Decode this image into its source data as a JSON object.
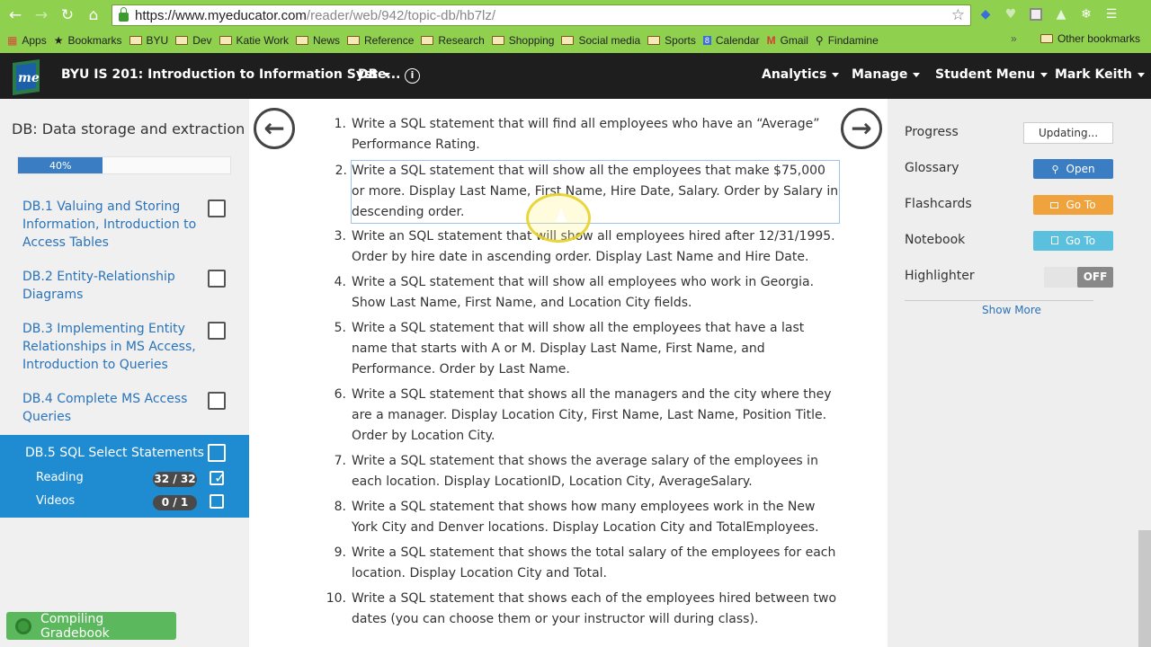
{
  "browser": {
    "url_host": "https://www.myeducator.com",
    "url_path": "/reader/web/942/topic-db/hb7lz/",
    "bookmarks": [
      "Apps",
      "Bookmarks",
      "BYU",
      "Dev",
      "Katie Work",
      "News",
      "Reference",
      "Research",
      "Shopping",
      "Social media",
      "Sports",
      "Calendar",
      "Gmail",
      "Findamine"
    ],
    "other_bookmarks": "Other bookmarks",
    "overflow": "»"
  },
  "appbar": {
    "course": "BYU IS 201: Introduction to Information Syste...",
    "db_menu": "DB",
    "analytics": "Analytics",
    "manage": "Manage",
    "student_menu": "Student Menu",
    "user": "Mark Keith",
    "logo_text": "me"
  },
  "sidebar": {
    "title": "DB: Data storage and extraction",
    "progress": "40%",
    "progress_value": 0.4,
    "sections": [
      {
        "label": "DB.1 Valuing and Storing Information, Introduction to Access Tables"
      },
      {
        "label": "DB.2 Entity-Relationship Diagrams"
      },
      {
        "label": "DB.3 Implementing Entity Relationships in MS Access, Introduction to Queries"
      },
      {
        "label": "DB.4 Complete MS Access Queries"
      }
    ],
    "active": {
      "label": "DB.5 SQL Select Statements",
      "reading_label": "Reading",
      "reading_badge": "32 / 32",
      "videos_label": "Videos",
      "videos_badge": "0 / 1"
    },
    "gradebook": "Compiling Gradebook"
  },
  "main": {
    "questions": [
      {
        "num": "1.",
        "text": "Write a SQL statement that will find all employees who have an “Average” Performance Rating."
      },
      {
        "num": "2.",
        "text": "Write a SQL statement that will show all the employees that make $75,000 or more. Display Last Name, First Name, Hire Date, Salary. Order by Salary in descending order."
      },
      {
        "num": "3.",
        "text": "Write an SQL statement that will show all employees hired after 12/31/1995. Order by hire date in ascending order. Display Last Name and Hire Date."
      },
      {
        "num": "4.",
        "text": "Write a SQL statement that will show all employees who work in Georgia. Show Last Name, First Name, and Location City fields."
      },
      {
        "num": "5.",
        "text": "Write a SQL statement that will show all the employees that have a last name that starts with A or M. Display Last Name, First Name, and Performance. Order by Last Name."
      },
      {
        "num": "6.",
        "text": "Write a SQL statement that shows all the managers and the city where they are a manager. Display Location City, First Name, Last Name, Position Title. Order by Location City."
      },
      {
        "num": "7.",
        "text": "Write a SQL statement that shows the average salary of the employees in each location. Display LocationID, Location City, AverageSalary."
      },
      {
        "num": "8.",
        "text": "Write a SQL statement that shows how many employees work in the New York City and Denver locations. Display Location City and TotalEmployees."
      },
      {
        "num": "9.",
        "text": "Write a SQL statement that shows the total salary of the employees for each location. Display Location City and Total."
      },
      {
        "num": "10.",
        "text": "Write a SQL statement that shows each of the employees hired between two dates (you can choose them or your instructor will during class)."
      }
    ]
  },
  "right": {
    "progress_label": "Progress",
    "progress_status": "Updating...",
    "glossary_label": "Glossary",
    "glossary_btn": "Open",
    "flashcards_label": "Flashcards",
    "flashcards_btn": "Go To",
    "notebook_label": "Notebook",
    "notebook_btn": "Go To",
    "highlighter_label": "Highlighter",
    "highlighter_state": "OFF",
    "show_more": "Show More",
    "colors": {
      "blue": "#3a7dc2",
      "orange": "#f0a23c",
      "teal": "#5bc0de"
    }
  }
}
